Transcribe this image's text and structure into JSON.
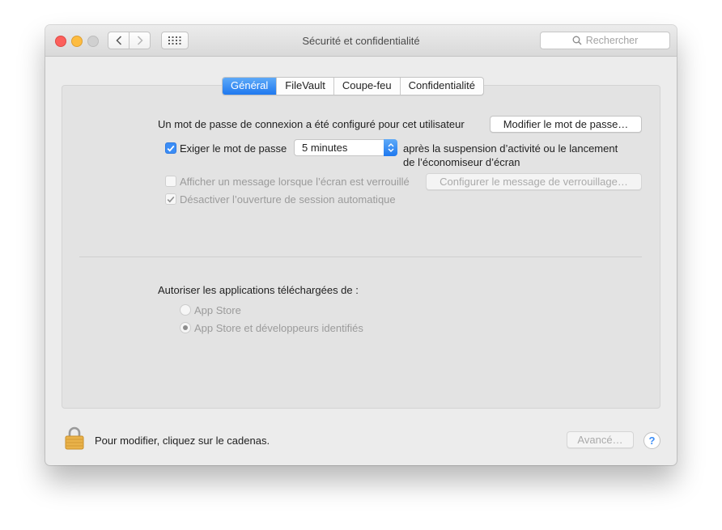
{
  "window": {
    "title": "Sécurité et confidentialité",
    "search_placeholder": "Rechercher"
  },
  "tabs": [
    {
      "label": "Général",
      "active": true
    },
    {
      "label": "FileVault",
      "active": false
    },
    {
      "label": "Coupe-feu",
      "active": false
    },
    {
      "label": "Confidentialité",
      "active": false
    }
  ],
  "general": {
    "password_set_text": "Un mot de passe de connexion a été configuré pour cet utilisateur",
    "change_password_button": "Modifier le mot de passe…",
    "require_password": {
      "label": "Exiger le mot de passe",
      "checked": true,
      "delay_value": "5 minutes",
      "after_text_line1": "après la suspension d’activité ou le lancement",
      "after_text_line2": "de l’économiseur d’écran"
    },
    "lock_message": {
      "label": "Afficher un message lorsque l’écran est verrouillé",
      "checked": false,
      "button": "Configurer le message de verrouillage…"
    },
    "disable_autologin": {
      "label": "Désactiver l’ouverture de session automatique",
      "checked": true
    },
    "allow_apps": {
      "heading": "Autoriser les applications téléchargées de :",
      "options": [
        {
          "label": "App Store",
          "selected": false
        },
        {
          "label": "App Store et développeurs identifiés",
          "selected": true
        }
      ]
    }
  },
  "footer": {
    "lock_text": "Pour modifier, cliquez sur le cadenas.",
    "advanced_button": "Avancé…",
    "help_label": "?"
  },
  "colors": {
    "accent": "#3b8df6",
    "window_bg": "#ececec",
    "pane_bg": "#e3e3e3",
    "lock_gold": "#e9b24a"
  }
}
